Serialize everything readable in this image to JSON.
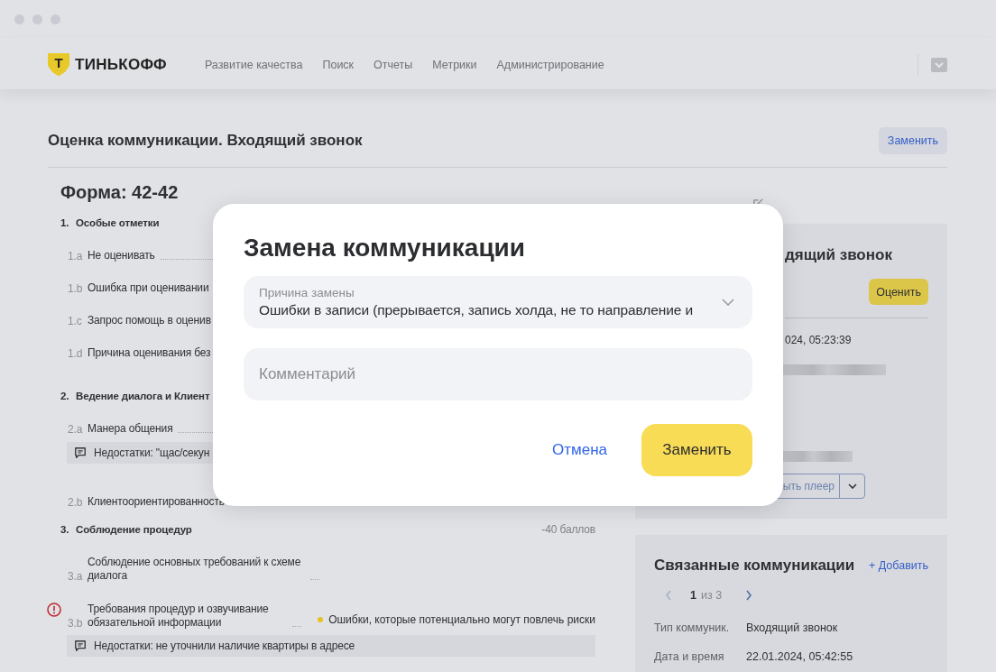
{
  "header": {
    "logo": {
      "mark": "Т",
      "name": "ТИНЬКОФФ"
    },
    "nav": [
      {
        "label": "Развитие качества"
      },
      {
        "label": "Поиск"
      },
      {
        "label": "Отчеты"
      },
      {
        "label": "Метрики"
      },
      {
        "label": "Администрирование"
      }
    ]
  },
  "page": {
    "title": "Оценка коммуникации. Входящий звонок",
    "replace_button": "Заменить"
  },
  "form": {
    "title": "Форма: 42-42",
    "sections": [
      {
        "number": "1.",
        "title": "Особые отметки",
        "items": [
          {
            "code": "1.a",
            "label": "Не оценивать",
            "flagged": false
          },
          {
            "code": "1.b",
            "label": "Ошибка при оценивании",
            "flagged": false
          },
          {
            "code": "1.c",
            "label": "Запрос помощь в оценив",
            "flagged": false
          },
          {
            "code": "1.d",
            "label": "Причина оценивания без",
            "flagged": false
          }
        ]
      },
      {
        "number": "2.",
        "title": "Ведение диалога и Клиент",
        "items": [
          {
            "code": "2.a",
            "label": "Манера общения",
            "flagged": false,
            "comment": "Недостатки: \"щас/секун"
          },
          {
            "code": "2.b",
            "label": "Клиентоориентированность",
            "flagged": false
          }
        ]
      },
      {
        "number": "3.",
        "title": "Соблюдение процедур",
        "score": "-40 баллов",
        "items": [
          {
            "code": "3.a",
            "label": "Соблюдение основных требований к схеме диалога",
            "flagged": false
          },
          {
            "code": "3.b",
            "label": "Требования процедур и озвучивание обязательной информации",
            "flagged": true,
            "note": {
              "text": "Ошибки, которые потенциально могут повлечь риски",
              "color": "#e5c21f"
            },
            "comment": "Недостатки: не уточнили наличие квартиры в адресе"
          }
        ]
      }
    ]
  },
  "card": {
    "title": "дящий звонок",
    "rate_button": "Оценить",
    "datetime": "024, 05:23:39",
    "player_button": "ыть плеер"
  },
  "related": {
    "title": "Связанные коммуникации",
    "add_link": "+ Добавить",
    "pager": {
      "current": "1",
      "total": "из 3"
    },
    "rows": [
      {
        "label": "Тип коммуник.",
        "value": "Входящий звонок"
      },
      {
        "label": "Дата и время",
        "value": "22.01.2024, 05:42:55"
      }
    ]
  },
  "modal": {
    "title": "Замена коммуникации",
    "reason": {
      "label": "Причина замены",
      "value": "Ошибки в записи (прерывается, запись холда, не то направление и"
    },
    "comment": {
      "placeholder": "Комментарий"
    },
    "cancel": "Отмена",
    "submit": "Заменить"
  }
}
